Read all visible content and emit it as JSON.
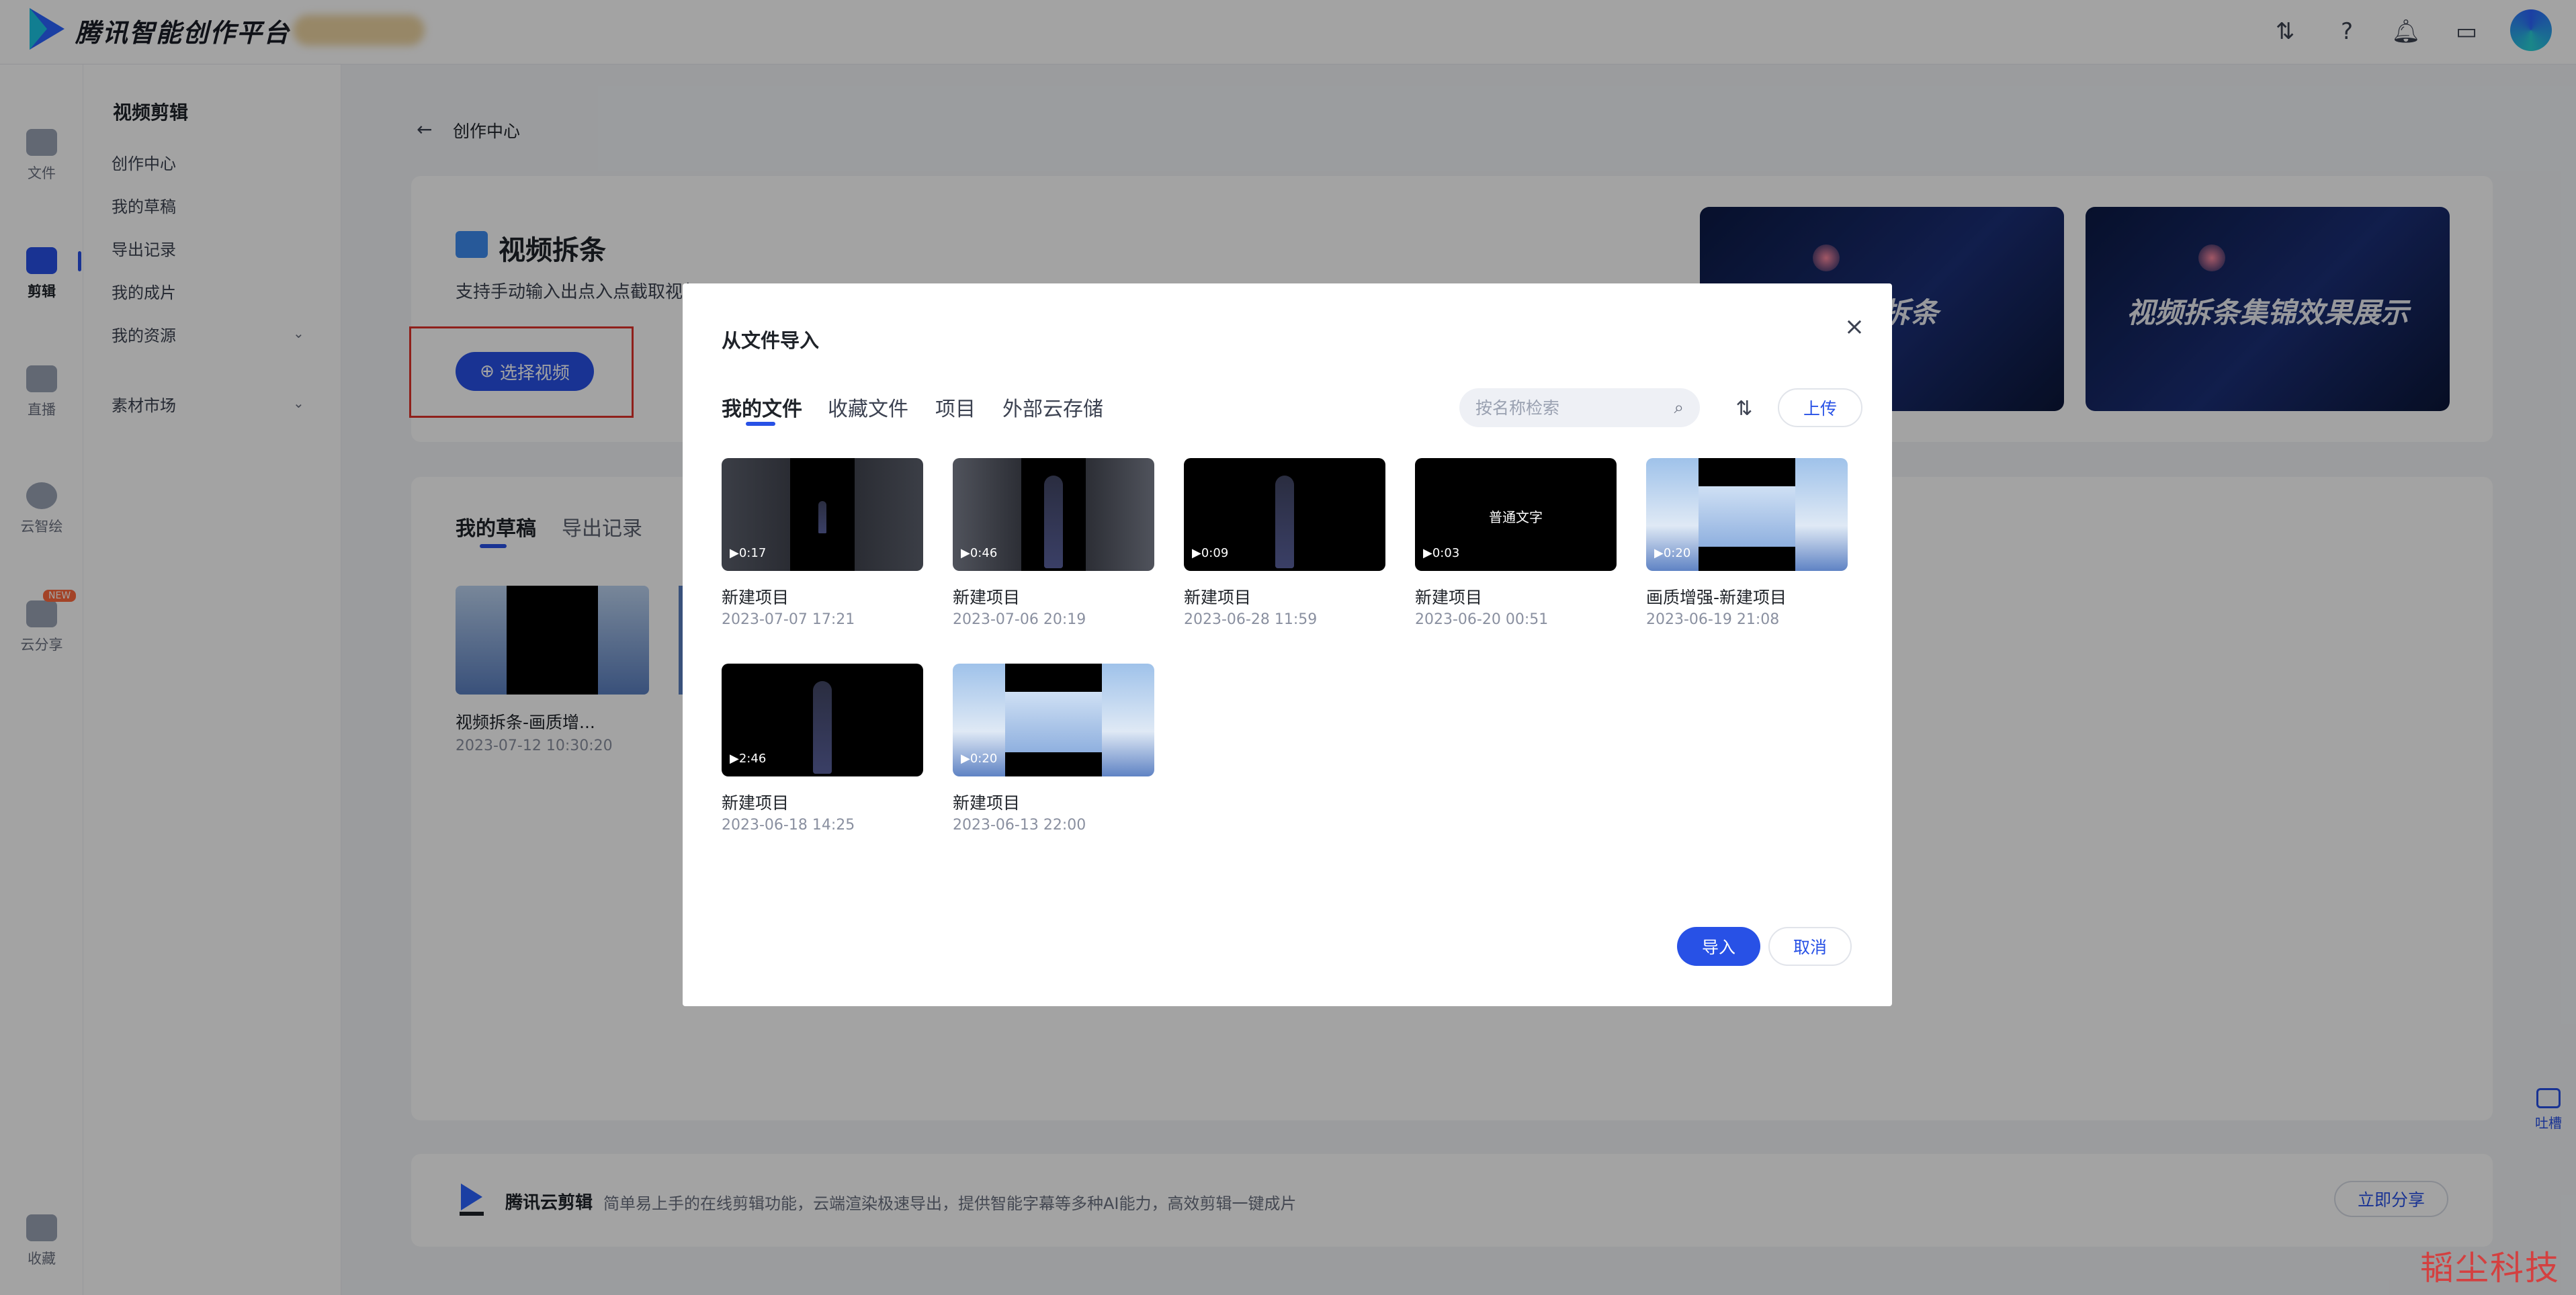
{
  "app": {
    "brand": "腾讯智能创作平台"
  },
  "rail": [
    {
      "label": "文件",
      "icon": "folder-icon"
    },
    {
      "label": "剪辑",
      "icon": "video-edit-icon"
    },
    {
      "label": "直播",
      "icon": "live-camera-icon"
    },
    {
      "label": "云智绘",
      "icon": "cloud-draw-icon"
    },
    {
      "label": "云分享",
      "icon": "cloud-share-icon",
      "badge": "NEW"
    },
    {
      "label": "收藏",
      "icon": "favorite-folder-icon"
    }
  ],
  "subnav": {
    "title": "视频剪辑",
    "items": [
      "创作中心",
      "我的草稿",
      "导出记录",
      "我的成片",
      "我的资源",
      "素材市场"
    ]
  },
  "main": {
    "breadcrumb": "创作中心",
    "feature_title": "视频拆条",
    "feature_desc": "支持手动输入出点入点截取视频",
    "select_button": "选择视频",
    "banners": [
      "视频拆条",
      "视频拆条集锦效果展示"
    ],
    "tabs": [
      "我的草稿",
      "导出记录"
    ],
    "draft": {
      "title": "视频拆条-画质增...",
      "date": "2023-07-12 10:30:20"
    },
    "promo": {
      "name": "腾讯云剪辑",
      "desc": "简单易上手的在线剪辑功能，云端渲染极速导出，提供智能字幕等多种AI能力，高效剪辑一键成片",
      "button": "立即分享"
    },
    "feedback": "吐槽",
    "watermark": "韬尘科技"
  },
  "modal": {
    "title": "从文件导入",
    "tabs": [
      "我的文件",
      "收藏文件",
      "项目",
      "外部云存储"
    ],
    "search": {
      "placeholder": "按名称检索",
      "value": ""
    },
    "upload": "上传",
    "import": "导入",
    "cancel": "取消",
    "files": [
      {
        "title": "新建项目",
        "date": "2023-07-07 17:21",
        "duration": "0:17",
        "style": "person-dim"
      },
      {
        "title": "新建项目",
        "date": "2023-07-06 20:19",
        "duration": "0:46",
        "style": "person-suit"
      },
      {
        "title": "新建项目",
        "date": "2023-06-28 11:59",
        "duration": "0:09",
        "style": "person-dress"
      },
      {
        "title": "新建项目",
        "date": "2023-06-20 00:51",
        "duration": "0:03",
        "style": "text",
        "text": "普通文字"
      },
      {
        "title": "画质增强-新建项目",
        "date": "2023-06-19 21:08",
        "duration": "0:20",
        "style": "sky"
      },
      {
        "title": "新建项目",
        "date": "2023-06-18 14:25",
        "duration": "2:46",
        "style": "person-dress"
      },
      {
        "title": "新建项目",
        "date": "2023-06-13 22:00",
        "duration": "0:20",
        "style": "sky"
      }
    ]
  }
}
